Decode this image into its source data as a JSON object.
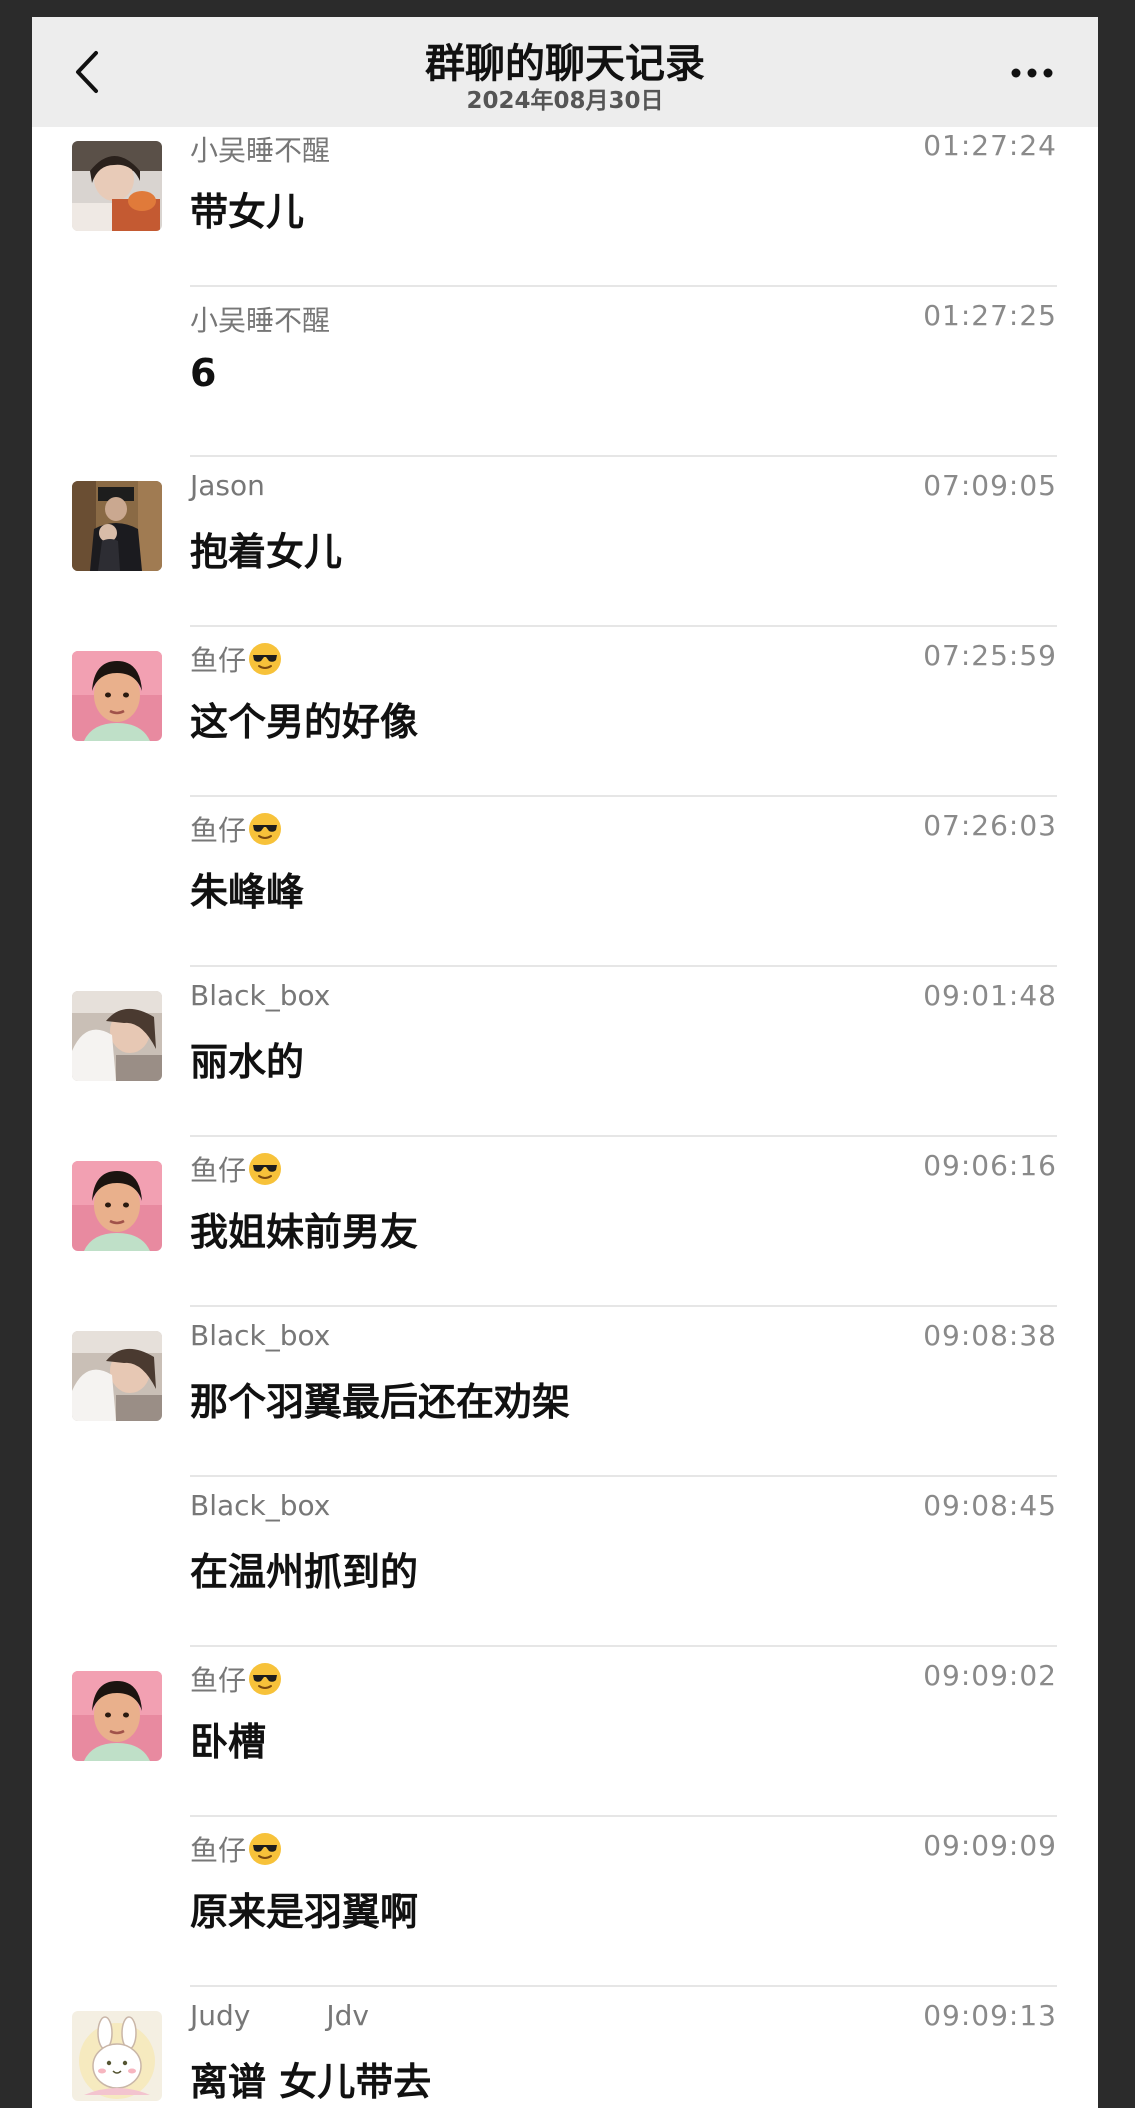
{
  "header": {
    "title": "群聊的聊天记录",
    "date": "2024年08月30日"
  },
  "icons": {
    "back": "chevron-left-icon",
    "more": "more-dots-icon",
    "emoji": "sunglasses-emoji"
  },
  "messages": [
    {
      "sender": "小吴睡不醒",
      "time": "01:27:24",
      "text": "带女儿",
      "avatar": "photo-girl"
    },
    {
      "sender": "小吴睡不醒",
      "time": "01:27:25",
      "text": "6",
      "avatar": ""
    },
    {
      "sender": "Jason",
      "time": "07:09:05",
      "text": "抱着女儿",
      "avatar": "photo-man"
    },
    {
      "sender": "鱼仔",
      "time": "07:25:59",
      "text": "这个男的好像",
      "avatar": "photo-boy",
      "emoji": true
    },
    {
      "sender": "鱼仔",
      "time": "07:26:03",
      "text": "朱峰峰",
      "avatar": "",
      "emoji": true
    },
    {
      "sender": "Black_box",
      "time": "09:01:48",
      "text": "丽水的",
      "avatar": "photo-woman"
    },
    {
      "sender": "鱼仔",
      "time": "09:06:16",
      "text": "我姐妹前男友",
      "avatar": "photo-boy",
      "emoji": true
    },
    {
      "sender": "Black_box",
      "time": "09:08:38",
      "text": "那个羽翼最后还在劝架",
      "avatar": "photo-woman"
    },
    {
      "sender": "Black_box",
      "time": "09:08:45",
      "text": "在温州抓到的",
      "avatar": ""
    },
    {
      "sender": "鱼仔",
      "time": "09:09:02",
      "text": "卧槽",
      "avatar": "photo-boy",
      "emoji": true
    },
    {
      "sender": "鱼仔",
      "time": "09:09:09",
      "text": "原来是羽翼啊",
      "avatar": "",
      "emoji": true
    },
    {
      "sender": "Judy",
      "sender_extra": "Jdv",
      "time": "09:09:13",
      "text": "离谱 女儿带去",
      "avatar": "bunny-cartoon"
    }
  ]
}
